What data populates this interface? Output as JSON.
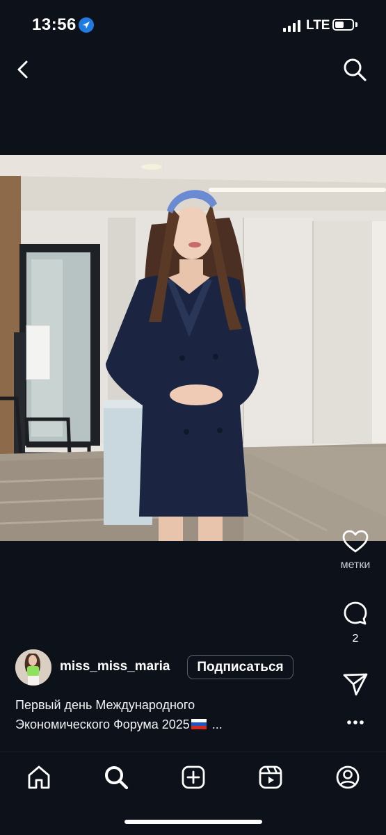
{
  "status_bar": {
    "time": "13:56",
    "network": "LTE",
    "battery_level": 0.5,
    "location_icon": "location-arrow-icon"
  },
  "header": {
    "back_icon": "chevron-left-icon",
    "search_icon": "search-icon"
  },
  "post": {
    "image_description_icon": "post-photo",
    "actions": {
      "like_icon": "heart-icon",
      "tags_label": "метки",
      "comment_icon": "comment-icon",
      "comment_count": "2",
      "share_icon": "send-icon",
      "more_icon": "more-dots-icon"
    },
    "author": {
      "username": "miss_miss_maria",
      "follow_label": "Подписаться"
    },
    "caption": {
      "line1": "Первый день Международного",
      "line2": "Экономического Форума 2025",
      "more": "..."
    }
  },
  "tab_bar": {
    "items": [
      "home-icon",
      "search-icon",
      "create-icon",
      "reels-icon",
      "profile-icon"
    ]
  },
  "colors": {
    "background": "#0d111a",
    "text": "#ffffff",
    "location_badge": "#1f7be0"
  }
}
